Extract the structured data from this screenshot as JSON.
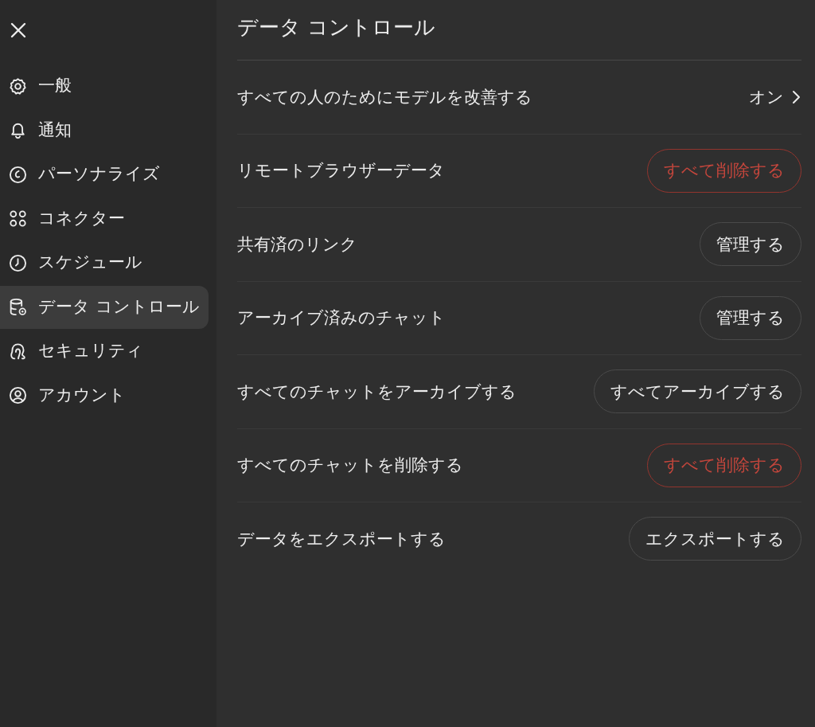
{
  "sidebar": {
    "items": [
      {
        "label": "一般",
        "selected": false
      },
      {
        "label": "通知",
        "selected": false
      },
      {
        "label": "パーソナライズ",
        "selected": false
      },
      {
        "label": "コネクター",
        "selected": false
      },
      {
        "label": "スケジュール",
        "selected": false
      },
      {
        "label": "データ コントロール",
        "selected": true
      },
      {
        "label": "セキュリティ",
        "selected": false
      },
      {
        "label": "アカウント",
        "selected": false
      }
    ]
  },
  "page": {
    "title": "データ コントロール"
  },
  "settings": [
    {
      "kind": "link",
      "label": "すべての人のためにモデルを改善する",
      "value": "オン"
    },
    {
      "kind": "button",
      "label": "リモートブラウザーデータ",
      "action": {
        "label": "すべて削除する",
        "danger": true
      }
    },
    {
      "kind": "button",
      "label": "共有済のリンク",
      "action": {
        "label": "管理する",
        "danger": false
      }
    },
    {
      "kind": "button",
      "label": "アーカイブ済みのチャット",
      "action": {
        "label": "管理する",
        "danger": false
      }
    },
    {
      "kind": "button",
      "label": "すべてのチャットをアーカイブする",
      "action": {
        "label": "すべてアーカイブする",
        "danger": false
      }
    },
    {
      "kind": "button",
      "label": "すべてのチャットを削除する",
      "action": {
        "label": "すべて削除する",
        "danger": true
      }
    },
    {
      "kind": "button",
      "label": "データをエクスポートする",
      "action": {
        "label": "エクスポートする",
        "danger": false
      }
    }
  ]
}
